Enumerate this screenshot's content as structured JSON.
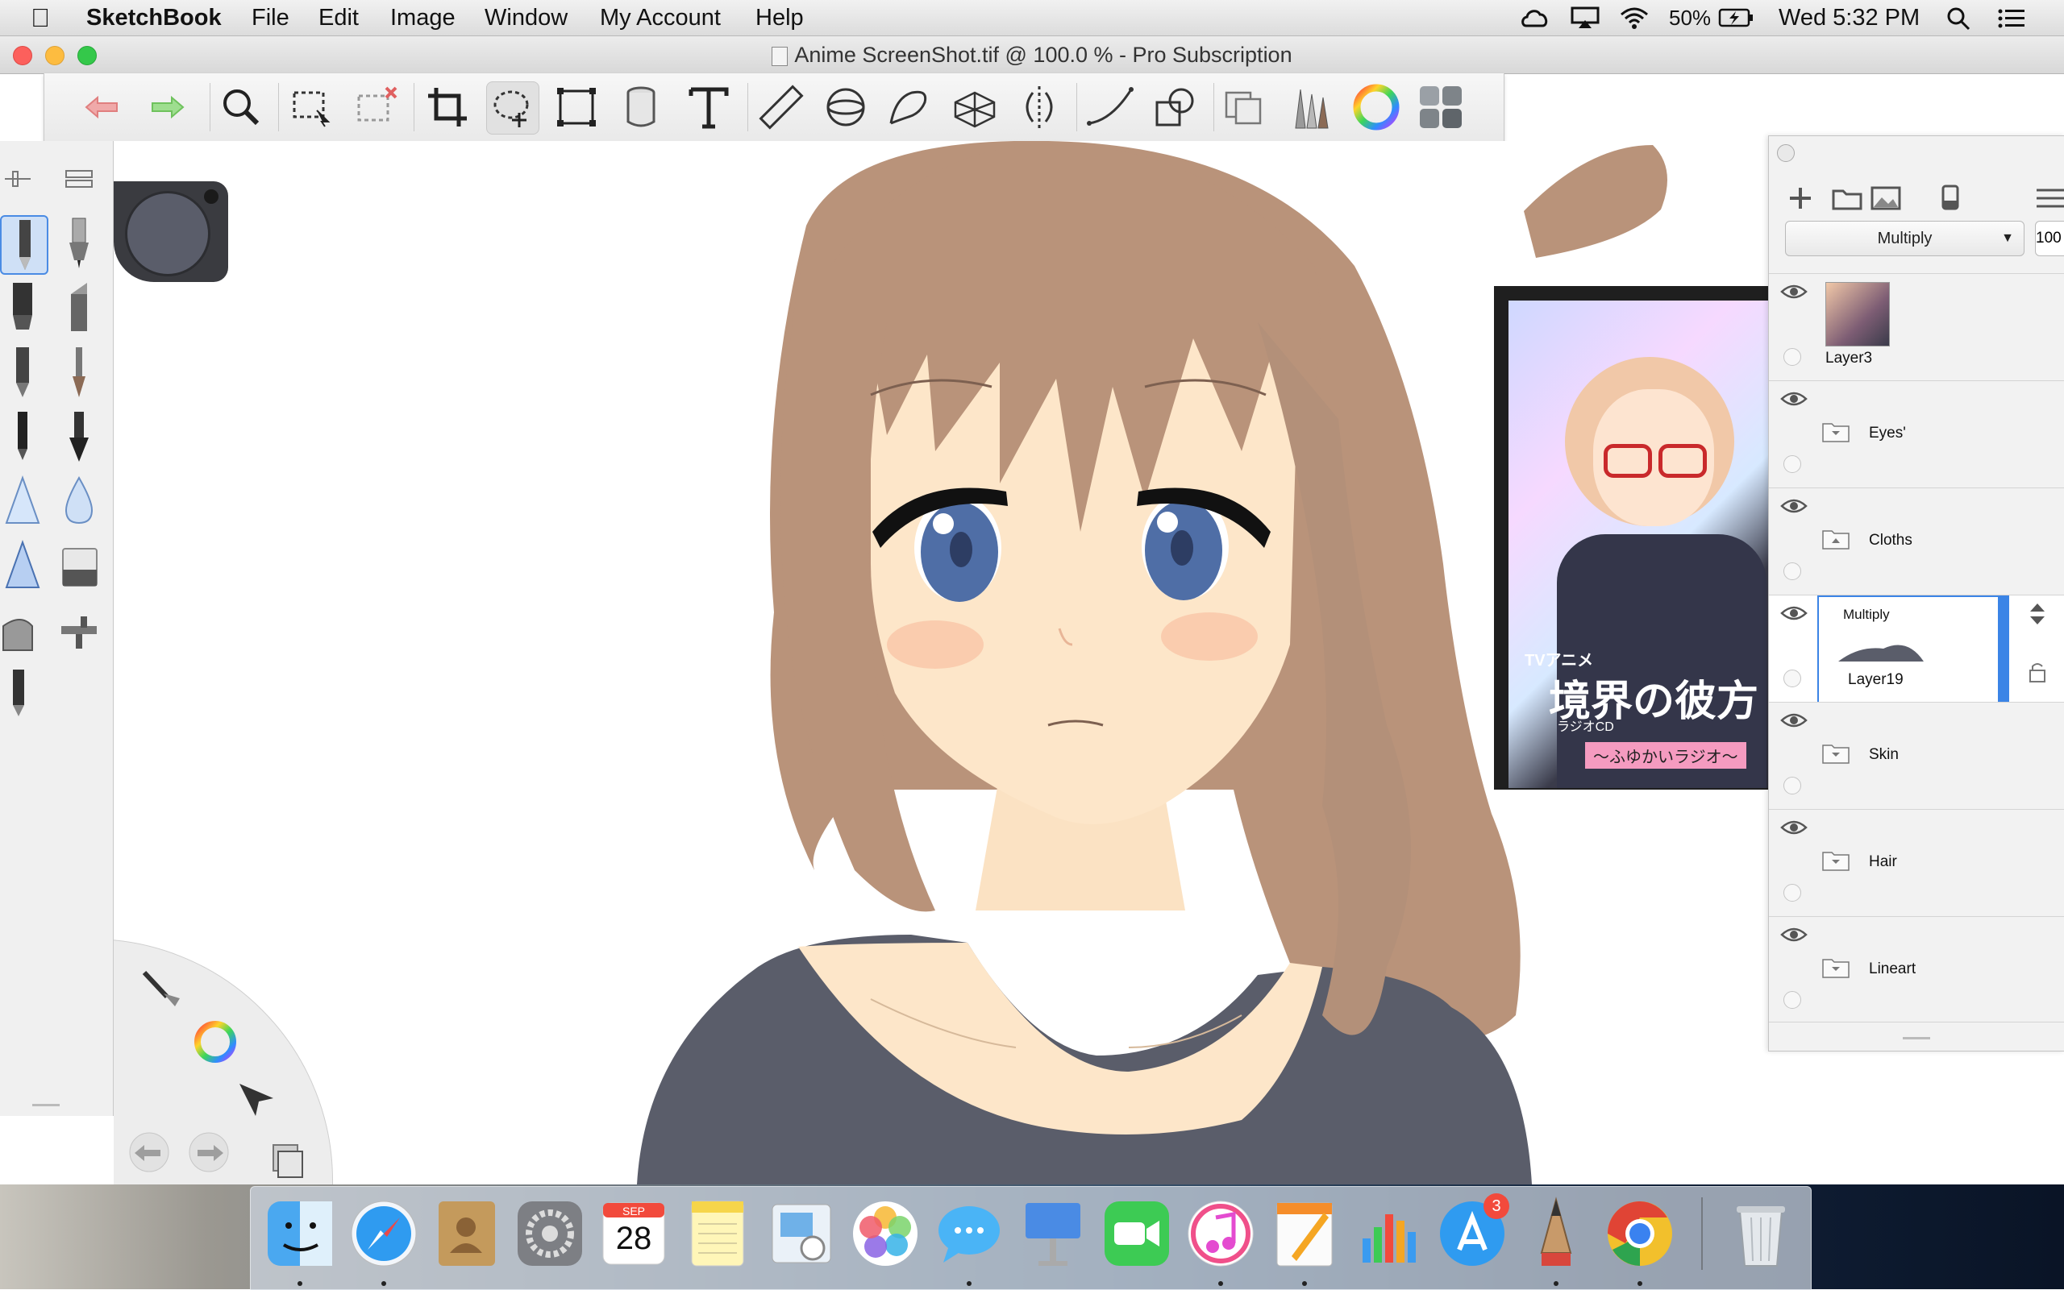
{
  "menubar": {
    "app_name": "SketchBook",
    "items": [
      "File",
      "Edit",
      "Image",
      "Window",
      "My Account",
      "Help"
    ],
    "battery_text": "50%",
    "clock": "Wed 5:32 PM"
  },
  "window": {
    "title": "Anime ScreenShot.tif @ 100.0 % - Pro Subscription"
  },
  "toolbar": {
    "tools": [
      "undo-icon",
      "redo-icon",
      "zoom-icon",
      "selection-icon",
      "clear-selection-icon",
      "crop-icon",
      "lasso-icon",
      "transform-icon",
      "fill-icon",
      "text-icon",
      "ruler-icon",
      "ellipse-guide-icon",
      "french-curve-icon",
      "perspective-icon",
      "symmetry-icon",
      "stroke-icon",
      "shape-icon",
      "layer-editor-icon",
      "brush-library-icon",
      "color-wheel-icon",
      "panels-icon"
    ]
  },
  "layers": {
    "blend_mode": "Multiply",
    "opacity_text": "100",
    "items": [
      {
        "name": "Layer3",
        "type": "image"
      },
      {
        "name": "Eyes'",
        "type": "folder"
      },
      {
        "name": "Cloths",
        "type": "folder"
      },
      {
        "name": "Layer19",
        "type": "layer",
        "blend": "Multiply",
        "selected": true
      },
      {
        "name": "Skin",
        "type": "folder"
      },
      {
        "name": "Hair",
        "type": "folder"
      },
      {
        "name": "Lineart",
        "type": "folder"
      }
    ]
  },
  "reference_image": {
    "caption_top": "TVアニメ",
    "caption_title": "境界の彼方",
    "caption_sub": "ラジオCD",
    "caption_banner": "〜ふゆかいラジオ〜"
  },
  "dock": {
    "calendar_month": "SEP",
    "calendar_day": "28",
    "appstore_badge": "3",
    "apps": [
      "finder-icon",
      "safari-icon",
      "contacts-icon",
      "system-preferences-icon",
      "calendar-icon",
      "notes-icon",
      "preview-icon",
      "photos-icon",
      "messages-icon",
      "keynote-icon",
      "facetime-icon",
      "itunes-icon",
      "pages-icon",
      "numbers-icon",
      "app-store-icon",
      "sketchbook-icon",
      "chrome-icon",
      "trash-icon"
    ]
  },
  "colors": {
    "hair": "#b9937a",
    "skin": "#fde6c9",
    "shirt": "#5a5d6a",
    "eyes": "#4f6ea6",
    "selected_accent": "#3b84e6"
  }
}
